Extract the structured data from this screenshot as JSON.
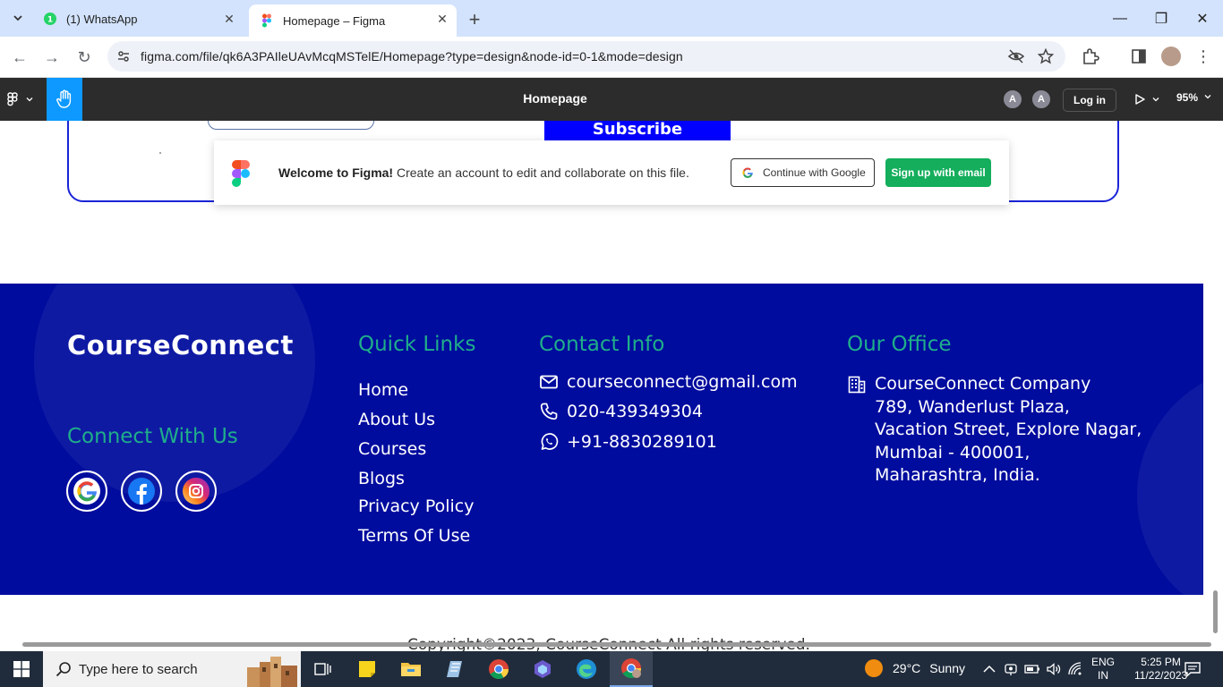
{
  "browser": {
    "tabs": [
      {
        "title": "(1) WhatsApp",
        "favicon": "whatsapp-icon"
      },
      {
        "title": "Homepage – Figma",
        "favicon": "figma-icon"
      }
    ],
    "url": "figma.com/file/qk6A3PAIleUAvMcqMSTelE/Homepage?type=design&node-id=0-1&mode=design"
  },
  "figma": {
    "file_title": "Homepage",
    "avatars": [
      "A",
      "A"
    ],
    "login_label": "Log in",
    "zoom": "95%",
    "accent": "#0d99ff"
  },
  "canvas": {
    "subscribe_label": "Subscribe",
    "welcome": {
      "bold": "Welcome to Figma!",
      "text": " Create an account to edit and collaborate on this file.",
      "google_button": "Continue with Google",
      "email_button": "Sign up with email"
    },
    "footer": {
      "brand": "CourseConnect",
      "connect_title": "Connect With Us",
      "quick_links_title": "Quick Links",
      "quick_links": [
        "Home",
        "About Us",
        "Courses",
        "Blogs",
        "Privacy Policy",
        "Terms Of Use"
      ],
      "contact_title": "Contact Info",
      "contact": {
        "email": "courseconnect@gmail.com",
        "phone": "020-439349304",
        "whatsapp": "+91-8830289101"
      },
      "office_title": "Our Office",
      "office_lines": [
        "CourseConnect Company",
        "789, Wanderlust Plaza,",
        "Vacation Street, Explore Nagar,",
        "Mumbai - 400001,",
        "Maharashtra, India."
      ],
      "copyright": "Copyright©2023, CourseConnect All rights reserved.",
      "colors": {
        "background": "#000c9e",
        "heading": "#1fae8a"
      }
    }
  },
  "taskbar": {
    "search_placeholder": "Type here to search",
    "weather_temp": "29°C",
    "weather_text": "Sunny",
    "lang_1": "ENG",
    "lang_2": "IN",
    "time": "5:25 PM",
    "date": "11/22/2023"
  }
}
